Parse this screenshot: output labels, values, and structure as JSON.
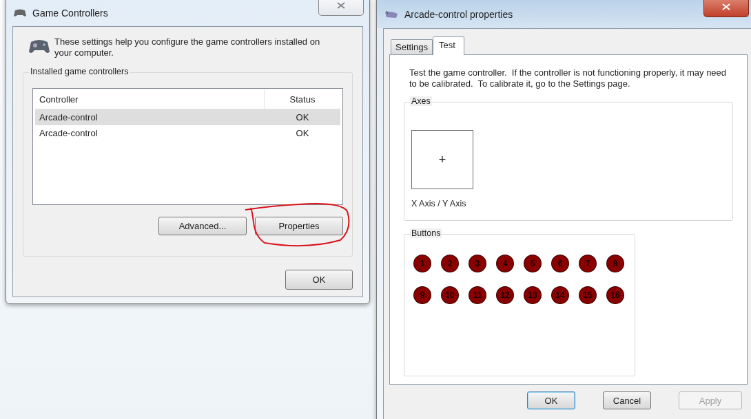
{
  "game_controllers_window": {
    "title": "Game Controllers",
    "description": "These settings help you configure the game controllers installed on your computer.",
    "group_label": "Installed game controllers",
    "table": {
      "columns": [
        "Controller",
        "Status"
      ],
      "rows": [
        {
          "controller": "Arcade-control",
          "status": "OK",
          "selected": true
        },
        {
          "controller": "Arcade-control",
          "status": "OK",
          "selected": false
        }
      ]
    },
    "buttons": [
      {
        "label": "Advanced..."
      },
      {
        "label": "Properties",
        "annotated": true
      }
    ],
    "ok_button": "OK"
  },
  "properties_window": {
    "title": "Arcade-control properties",
    "tabs": [
      {
        "label": "Settings",
        "selected": false
      },
      {
        "label": "Test",
        "selected": true
      }
    ],
    "instructions": "Test the game controller.  If the controller is not functioning properly, it may need to be calibrated.  To calibrate it, go to the Settings page.",
    "axes": {
      "label": "Axes",
      "marker": "+",
      "caption": "X Axis / Y Axis"
    },
    "buttons_group": {
      "label": "Buttons",
      "indicators": [
        {
          "number": "1",
          "pressed": false
        },
        {
          "number": "2",
          "pressed": false
        },
        {
          "number": "3",
          "pressed": false
        },
        {
          "number": "4",
          "pressed": false
        },
        {
          "number": "5",
          "pressed": false
        },
        {
          "number": "6",
          "pressed": false
        },
        {
          "number": "7",
          "pressed": false
        },
        {
          "number": "8",
          "pressed": false
        },
        {
          "number": "9",
          "pressed": false
        },
        {
          "number": "10",
          "pressed": false
        },
        {
          "number": "11",
          "pressed": false
        },
        {
          "number": "12",
          "pressed": false
        },
        {
          "number": "13",
          "pressed": false
        },
        {
          "number": "14",
          "pressed": false
        },
        {
          "number": "15",
          "pressed": false
        },
        {
          "number": "16",
          "pressed": false
        }
      ]
    },
    "dialog_buttons": [
      {
        "label": "OK",
        "default": true,
        "disabled": false
      },
      {
        "label": "Cancel",
        "default": false,
        "disabled": false
      },
      {
        "label": "Apply",
        "default": false,
        "disabled": true
      }
    ]
  }
}
